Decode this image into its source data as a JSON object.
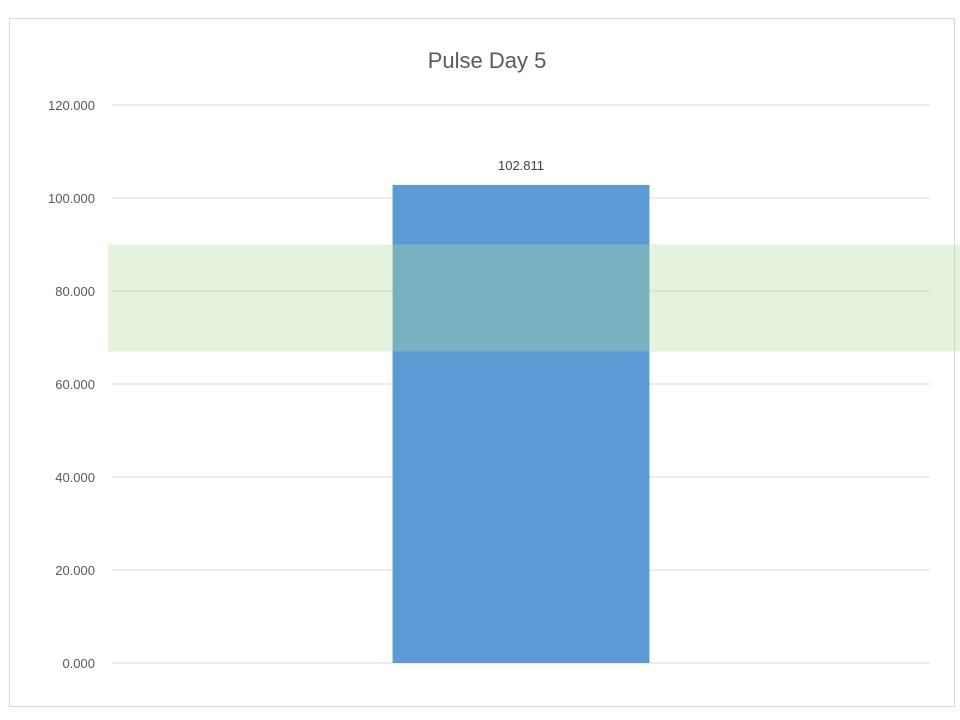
{
  "chart_data": {
    "type": "bar",
    "title": "Pulse Day 5",
    "xlabel": "",
    "ylabel": "",
    "categories": [
      ""
    ],
    "values": [
      102.811
    ],
    "data_labels": [
      "102.811"
    ],
    "ylim": [
      0,
      120
    ],
    "yticks": [
      0,
      20,
      40,
      60,
      80,
      100,
      120
    ],
    "ytick_labels": [
      "0.000",
      "20.000",
      "40.000",
      "60.000",
      "80.000",
      "100.000",
      "120.000"
    ],
    "grid": true,
    "legend": "none",
    "reference_band": {
      "from": 67,
      "to": 90,
      "color": "#e2efd9"
    },
    "colors": {
      "bar": "#5b9bd5",
      "grid": "#d9d9d9",
      "band": "#e2efd9"
    }
  }
}
